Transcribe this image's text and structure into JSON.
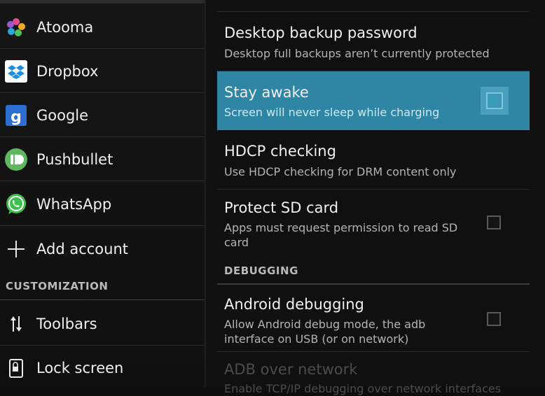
{
  "accounts": [
    {
      "label": "Atooma",
      "icon": "atooma-icon"
    },
    {
      "label": "Dropbox",
      "icon": "dropbox-icon"
    },
    {
      "label": "Google",
      "icon": "google-icon"
    },
    {
      "label": "Pushbullet",
      "icon": "pushbullet-icon"
    },
    {
      "label": "WhatsApp",
      "icon": "whatsapp-icon"
    },
    {
      "label": "Add account",
      "icon": "plus-icon"
    }
  ],
  "customization": {
    "header": "CUSTOMIZATION",
    "items": [
      {
        "label": "Toolbars",
        "icon": "toolbars-icon"
      },
      {
        "label": "Lock screen",
        "icon": "lock-screen-icon"
      }
    ]
  },
  "prefs": {
    "desktop_backup": {
      "title": "Desktop backup password",
      "summary": "Desktop full backups aren’t currently protected"
    },
    "stay_awake": {
      "title": "Stay awake",
      "summary": "Screen will never sleep while charging",
      "checked": false
    },
    "hdcp": {
      "title": "HDCP checking",
      "summary": "Use HDCP checking for DRM content only"
    },
    "protect_sd": {
      "title": "Protect SD card",
      "summary": "Apps must request permission to read SD card",
      "checked": false
    }
  },
  "debugging": {
    "header": "DEBUGGING",
    "android_debugging": {
      "title": "Android debugging",
      "summary": "Allow Android debug mode, the adb interface on USB (or on network)",
      "checked": false
    },
    "adb_network": {
      "title": "ADB over network",
      "summary": "Enable TCP/IP debugging over network interfaces"
    }
  },
  "colors": {
    "accent": "#2e86a4",
    "background": "#101010"
  }
}
